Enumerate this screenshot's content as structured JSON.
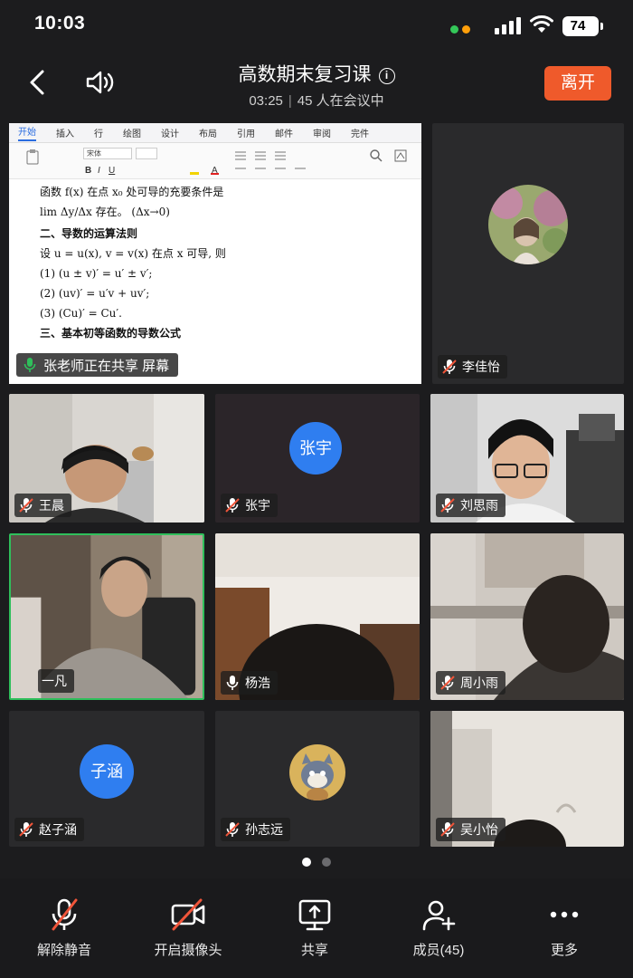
{
  "status_bar": {
    "time": "10:03",
    "battery": "74",
    "indicator_colors": [
      "#34c759",
      "#ff9f0a"
    ]
  },
  "header": {
    "title": "高数期末复习课",
    "elapsed": "03:25",
    "participants": "45 人在会议中",
    "leave_label": "离开",
    "leave_color": "#ef5a2b"
  },
  "share": {
    "status_label": "张老师正在共享 屏幕",
    "ribbon_tabs": [
      "开始",
      "插入",
      "行",
      "绘图",
      "设计",
      "布局",
      "引用",
      "邮件",
      "审阅",
      "完件"
    ],
    "font_name": "宋体",
    "doc_lines": [
      {
        "text": "函数 f(x) 在点 x₀ 处可导的充要条件是",
        "bold": false
      },
      {
        "text": "lim Δy/Δx 存在。 (Δx→0)",
        "bold": false
      },
      {
        "text": "二、导数的运算法则",
        "bold": true
      },
      {
        "text": "设 u = u(x), v = v(x) 在点 x 可导, 则",
        "bold": false
      },
      {
        "text": "(1)  (u ± v)′ = u′ ± v′;",
        "bold": false
      },
      {
        "text": "(2)  (uv)′ = u′v + uv′;",
        "bold": false
      },
      {
        "text": "(3)  (Cu)′ = Cu′.",
        "bold": false
      },
      {
        "text": "三、基本初等函数的导数公式",
        "bold": true
      }
    ]
  },
  "participants": [
    {
      "name": "李佳怡",
      "muted": true
    },
    {
      "name": "王晨",
      "muted": true
    },
    {
      "name": "张宇",
      "muted": true,
      "initials": "张宇"
    },
    {
      "name": "刘思雨",
      "muted": true
    },
    {
      "name": "一凡",
      "muted": false,
      "speaking": true
    },
    {
      "name": "杨浩",
      "muted": false
    },
    {
      "name": "周小雨",
      "muted": true
    },
    {
      "name": "赵子涵",
      "muted": true,
      "initials": "子涵"
    },
    {
      "name": "孙志远",
      "muted": true
    },
    {
      "name": "吴小怡",
      "muted": true
    }
  ],
  "pager": {
    "current": 1,
    "total": 2
  },
  "toolbar": {
    "unmute": "解除静音",
    "camera": "开启摄像头",
    "share": "共享",
    "members": "成员(45)",
    "more": "更多"
  },
  "colors": {
    "background": "#1c1c1e",
    "accent_blue": "#2f7ef0",
    "mute_red": "#f0553a",
    "speaking_border": "#2fbf5b"
  }
}
